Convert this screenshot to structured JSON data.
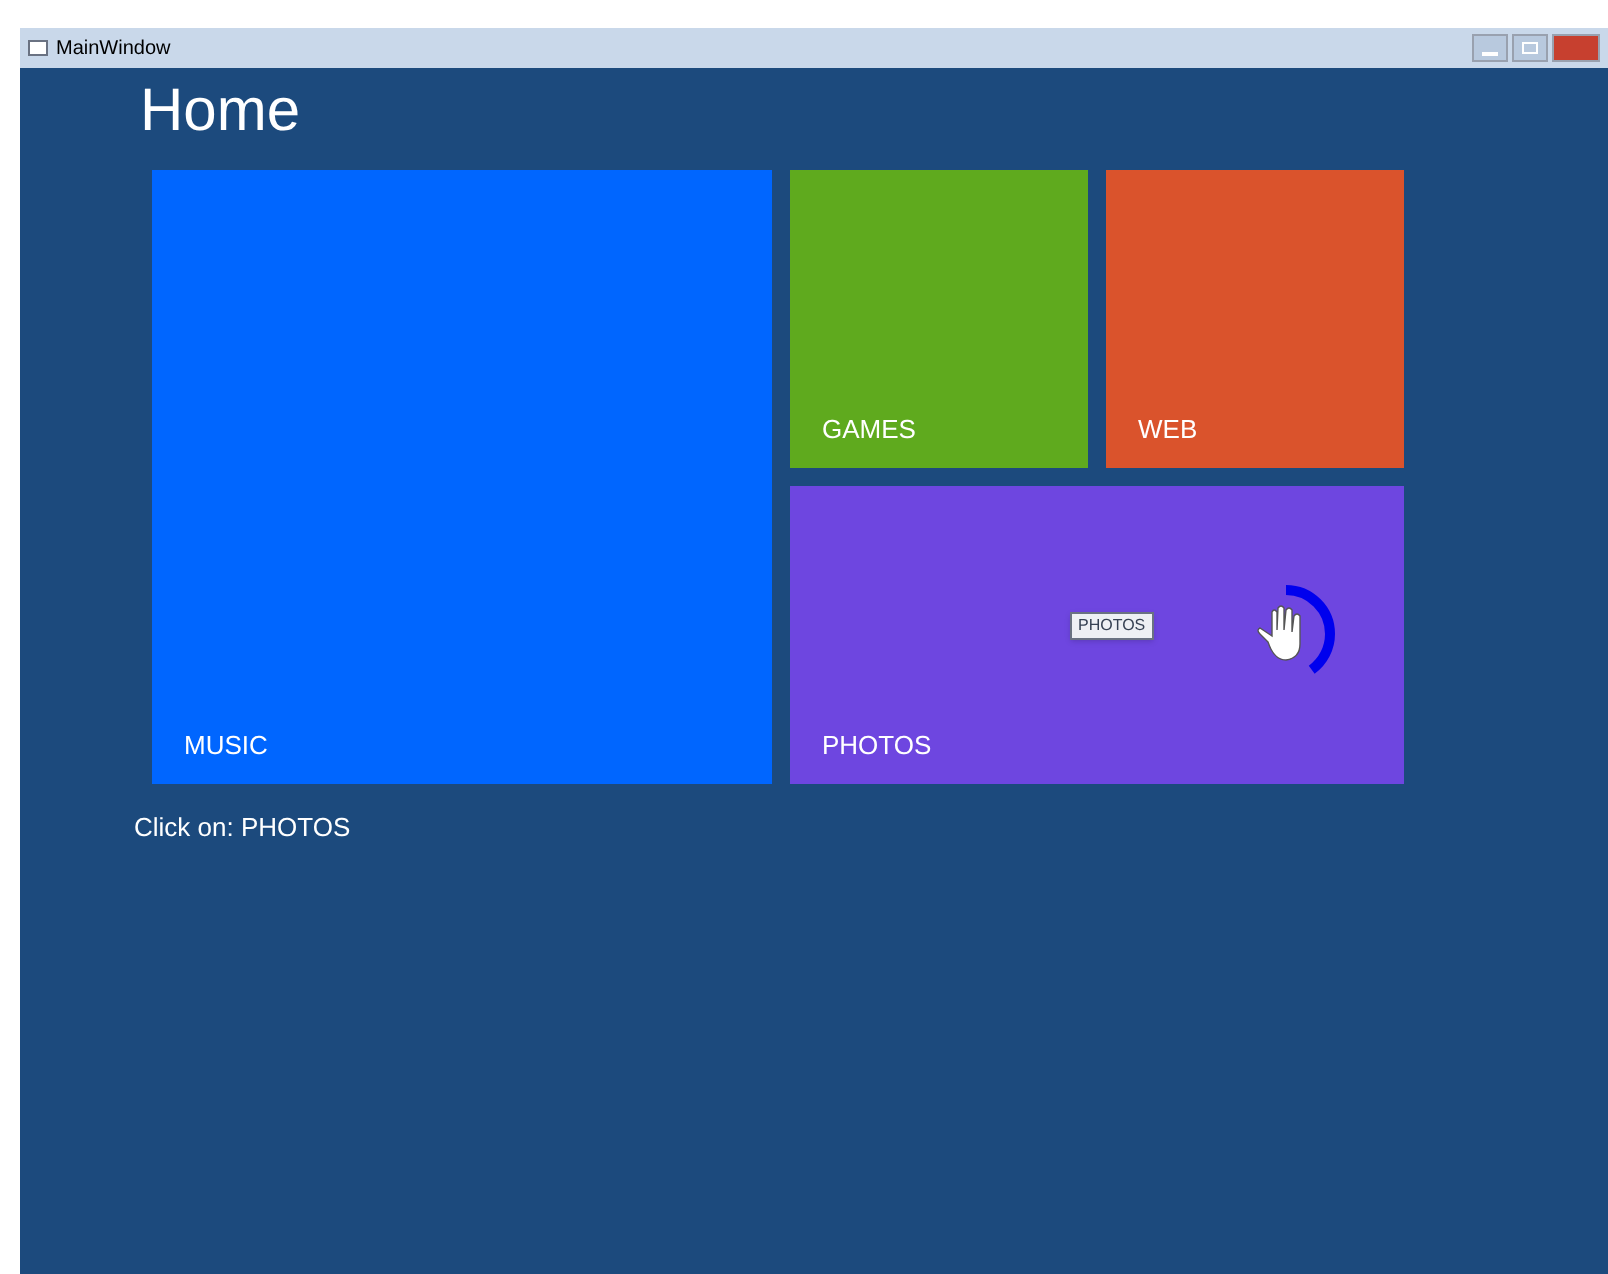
{
  "window": {
    "title": "MainWindow"
  },
  "page_title": "Home",
  "tiles": [
    {
      "label": "MUSIC",
      "kind": "large",
      "color": "#0066ff"
    },
    {
      "label": "GAMES",
      "kind": "small",
      "color": "#5faa1e"
    },
    {
      "label": "WEB",
      "kind": "small",
      "color": "#da532c"
    },
    {
      "label": "PHOTOS",
      "kind": "wide",
      "color": "#6e46e0",
      "hover": {
        "tooltip": "PHOTOS",
        "level": 0.4
      }
    }
  ],
  "status": "Click on: PHOTOS"
}
